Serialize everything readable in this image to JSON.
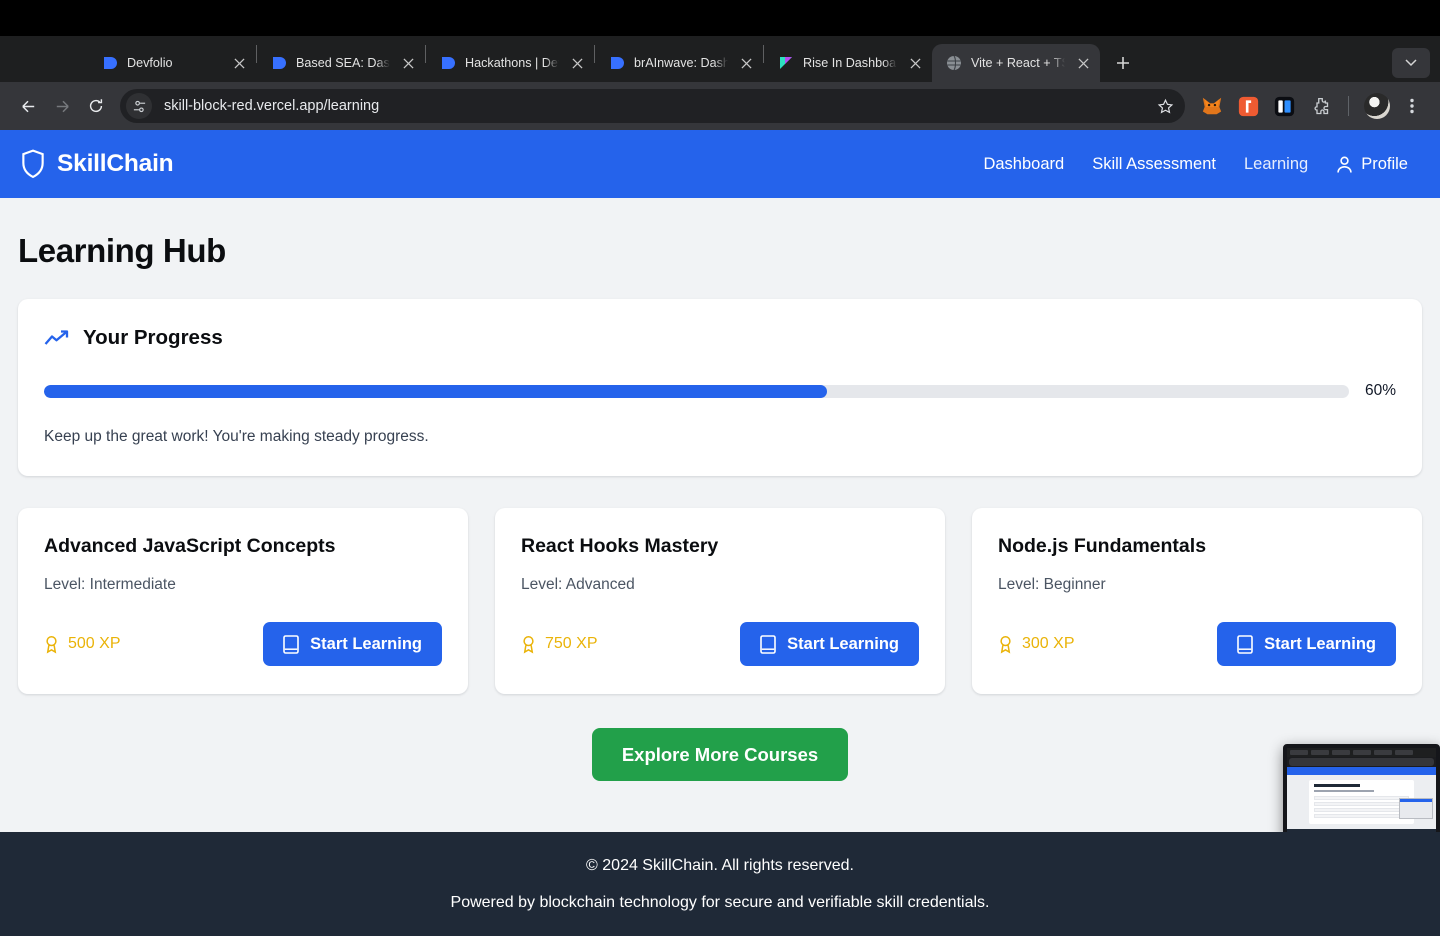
{
  "browser": {
    "tabs": [
      {
        "title": "Devfolio",
        "favicon": "devfolio-icon",
        "active": false
      },
      {
        "title": "Based SEA: Dashboard",
        "favicon": "devfolio-icon",
        "active": false
      },
      {
        "title": "Hackathons | Devfolio",
        "favicon": "devfolio-icon",
        "active": false
      },
      {
        "title": "brAInwave: Dashboard",
        "favicon": "devfolio-icon",
        "active": false
      },
      {
        "title": "Rise In Dashboard |",
        "favicon": "risein-icon",
        "active": false
      },
      {
        "title": "Vite + React + TS",
        "favicon": "globe-icon",
        "active": true
      }
    ],
    "new_tab_label": "+",
    "tab_list_label": "⌄",
    "nav": {
      "back": "back-arrow-icon",
      "forward": "forward-arrow-icon",
      "reload": "reload-icon"
    },
    "omnibox": {
      "site_settings_icon": "tune-icon",
      "url": "skill-block-red.vercel.app/learning",
      "bookmark_icon": "star-icon"
    },
    "extensions": [
      "metamask-fox-icon",
      "orange-extension-icon",
      "blue-extension-icon",
      "puzzle-piece-extensions-icon"
    ],
    "profile_avatar": "avatar",
    "menu_icon": "three-dot-menu-icon"
  },
  "app": {
    "brand": {
      "icon": "shield-icon",
      "name": "SkillChain"
    },
    "nav": [
      {
        "label": "Dashboard",
        "active": false
      },
      {
        "label": "Skill Assessment",
        "active": false
      },
      {
        "label": "Learning",
        "active": true
      },
      {
        "label": "Profile",
        "active": false,
        "icon": "user-icon"
      }
    ],
    "page_title": "Learning Hub",
    "progress": {
      "icon": "trending-up-icon",
      "title": "Your Progress",
      "percent": 60,
      "percent_label": "60%",
      "note": "Keep up the great work! You're making steady progress.",
      "fill_color": "#2563eb",
      "track_color": "#e5e7eb"
    },
    "courses": [
      {
        "title": "Advanced JavaScript Concepts",
        "level_label": "Level: Intermediate",
        "xp_label": "500 XP",
        "xp_icon": "award-icon",
        "cta_label": "Start Learning",
        "cta_icon": "book-icon"
      },
      {
        "title": "React Hooks Mastery",
        "level_label": "Level: Advanced",
        "xp_label": "750 XP",
        "xp_icon": "award-icon",
        "cta_label": "Start Learning",
        "cta_icon": "book-icon"
      },
      {
        "title": "Node.js Fundamentals",
        "level_label": "Level: Beginner",
        "xp_label": "300 XP",
        "xp_icon": "award-icon",
        "cta_label": "Start Learning",
        "cta_icon": "book-icon"
      }
    ],
    "explore_label": "Explore More Courses",
    "footer": {
      "copyright": "© 2024 SkillChain. All rights reserved.",
      "tagline": "Powered by blockchain technology for secure and verifiable skill credentials."
    },
    "colors": {
      "brand_blue": "#2563eb",
      "accent_green": "#22a04a",
      "xp_amber": "#eab308",
      "footer_navy": "#1f2937",
      "page_bg": "#f1f3f5"
    }
  }
}
